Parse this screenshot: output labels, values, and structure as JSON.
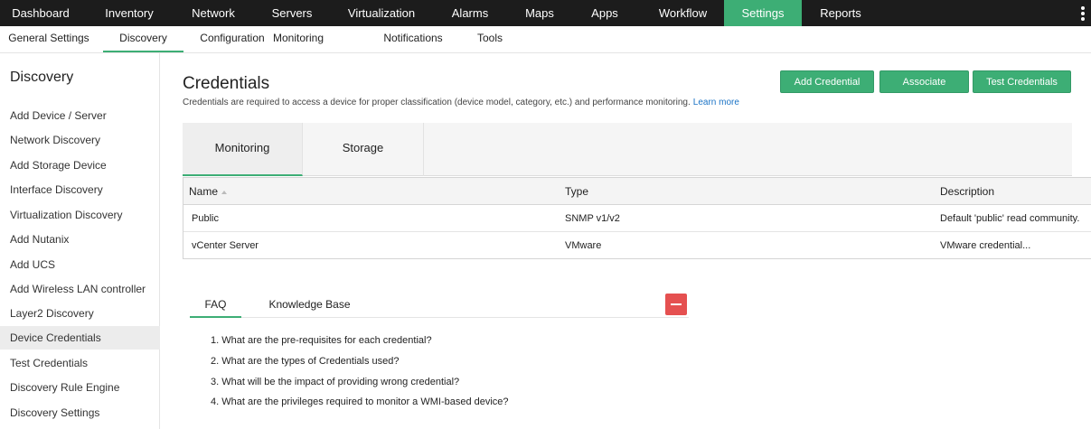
{
  "topnav": {
    "items": [
      {
        "label": "Dashboard"
      },
      {
        "label": "Inventory"
      },
      {
        "label": "Network"
      },
      {
        "label": "Servers"
      },
      {
        "label": "Virtualization"
      },
      {
        "label": "Alarms"
      },
      {
        "label": "Maps"
      },
      {
        "label": "Apps"
      },
      {
        "label": "Workflow"
      },
      {
        "label": "Settings",
        "active": true
      },
      {
        "label": "Reports"
      }
    ],
    "menu_icon": "vertical-ellipsis-icon",
    "active_color": "#3dae75"
  },
  "subnav": {
    "items": [
      {
        "label": "General Settings"
      },
      {
        "label": "Discovery",
        "active": true
      },
      {
        "label": "Configuration"
      },
      {
        "label": "Monitoring"
      },
      {
        "label": "Notifications"
      },
      {
        "label": "Tools"
      }
    ]
  },
  "sidebar": {
    "title": "Discovery",
    "items": [
      {
        "label": "Add Device / Server"
      },
      {
        "label": "Network Discovery"
      },
      {
        "label": "Add Storage Device"
      },
      {
        "label": "Interface Discovery"
      },
      {
        "label": "Virtualization Discovery"
      },
      {
        "label": "Add Nutanix"
      },
      {
        "label": "Add UCS"
      },
      {
        "label": "Add Wireless LAN controller"
      },
      {
        "label": "Layer2 Discovery"
      },
      {
        "label": "Device Credentials",
        "active": true
      },
      {
        "label": "Test Credentials"
      },
      {
        "label": "Discovery Rule Engine"
      },
      {
        "label": "Discovery Settings"
      }
    ]
  },
  "main": {
    "title": "Credentials",
    "description": "Credentials are required to access a device for proper classification (device model, category, etc.) and performance monitoring.",
    "learn_more": "Learn more",
    "buttons": {
      "add": "Add Credential",
      "associate": "Associate",
      "test": "Test Credentials"
    },
    "tabs": [
      {
        "label": "Monitoring",
        "active": true
      },
      {
        "label": "Storage"
      }
    ],
    "table": {
      "columns": [
        "Name",
        "Type",
        "Description"
      ],
      "sort_icon": "sort-ascending-icon",
      "rows": [
        [
          "Public",
          "SNMP v1/v2",
          "Default 'public' read community."
        ],
        [
          "vCenter Server",
          "VMware",
          "VMware credential..."
        ]
      ]
    }
  },
  "faq": {
    "tabs": [
      {
        "label": "FAQ",
        "active": true
      },
      {
        "label": "Knowledge Base"
      }
    ],
    "collapse_icon": "minus-icon",
    "questions": [
      "1. What are the pre-requisites for each credential?",
      "2. What are the types of Credentials used?",
      "3. What will be the impact of providing wrong credential?",
      "4. What are the privileges required to monitor a WMI-based device?"
    ]
  }
}
